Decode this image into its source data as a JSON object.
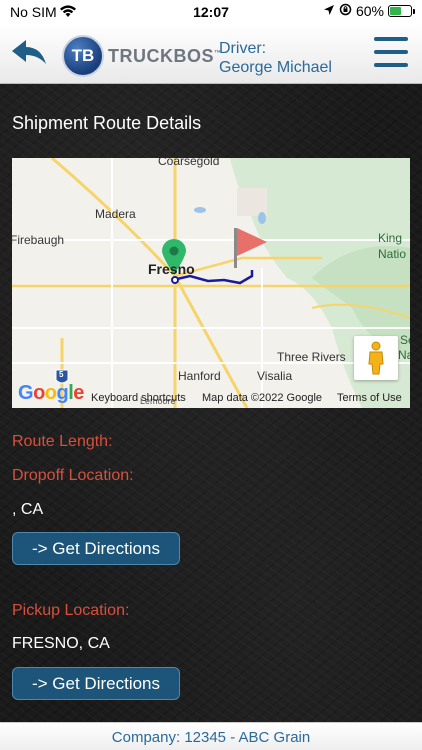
{
  "status_bar": {
    "carrier": "No SIM",
    "time": "12:07",
    "battery_text": "60%",
    "battery_level": 0.6
  },
  "header": {
    "logo_initials": "TB",
    "logo_name": "TRUCKBOS",
    "logo_mark": "™",
    "driver_label": "Driver:",
    "driver_name": "George Michael"
  },
  "page": {
    "title": "Shipment Route Details"
  },
  "map": {
    "labels": {
      "coarsegold": "Coarsegold",
      "madera": "Madera",
      "firebaugh": "Firebaugh",
      "fresno": "Fresno",
      "hanford": "Hanford",
      "visalia": "Visalia",
      "three_rivers": "Three Rivers",
      "kings": "King",
      "nati": "Natio",
      "seq1": "Se",
      "seq2": "Natio",
      "lemoore": "Lemoore",
      "route5": "5"
    },
    "google": "Google",
    "keyboard_shortcuts": "Keyboard shortcuts",
    "map_data": "Map data ©2022 Google",
    "terms": "Terms of Use",
    "colors": {
      "route": "#1a1a9e",
      "start_pin": "#2fb86a",
      "end_flag": "#e8706a",
      "park": "#cfe6cc",
      "road": "#f6d46a"
    }
  },
  "details": {
    "route_length_label": "Route Length:",
    "dropoff_label": "Dropoff Location:",
    "dropoff_value": ", CA",
    "dropoff_button": "-> Get Directions",
    "pickup_label": "Pickup Location:",
    "pickup_value": "FRESNO, CA",
    "pickup_button": "-> Get Directions"
  },
  "footer": {
    "company": "Company: 12345 - ABC Grain"
  }
}
